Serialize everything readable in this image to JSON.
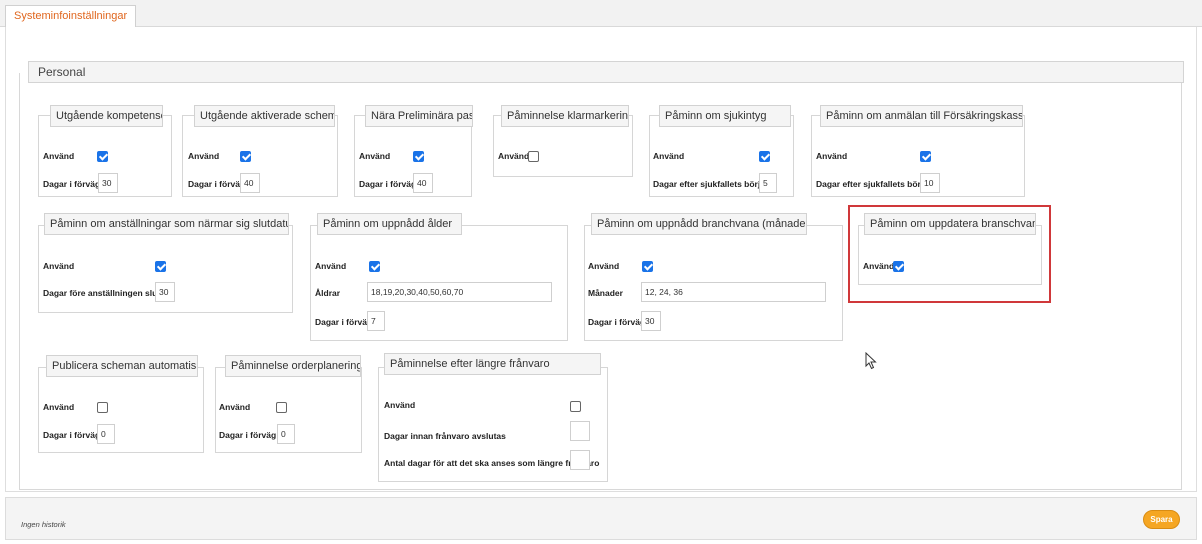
{
  "tab": {
    "label": "Systeminfoinställningar"
  },
  "section": {
    "title": "Personal"
  },
  "groups": [
    {
      "title": "Utgående kompetenser",
      "use_label": "Använd",
      "use_checked": true,
      "field_label": "Dagar i förväg",
      "field_value": "30"
    },
    {
      "title": "Utgående aktiverade scheman",
      "use_label": "Använd",
      "use_checked": true,
      "field_label": "Dagar i förväg",
      "field_value": "40"
    },
    {
      "title": "Nära Preliminära pass",
      "use_label": "Använd",
      "use_checked": true,
      "field_label": "Dagar i förväg",
      "field_value": "40"
    },
    {
      "title": "Påminnelse klarmarkering",
      "use_label": "Använd",
      "use_checked": false
    },
    {
      "title": "Påminn om sjukintyg",
      "use_label": "Använd",
      "use_checked": true,
      "field_label": "Dagar efter sjukfallets början",
      "field_value": "5"
    },
    {
      "title": "Påminn om anmälan till Försäkringskassan",
      "use_label": "Använd",
      "use_checked": true,
      "field_label": "Dagar efter sjukfallets början",
      "field_value": "10"
    },
    {
      "title": "Påminn om anställningar som närmar sig slutdatum",
      "use_label": "Använd",
      "use_checked": true,
      "field_label": "Dagar före anställningen slutar",
      "field_value": "30"
    },
    {
      "title": "Påminn om uppnådd ålder",
      "use_label": "Använd",
      "use_checked": true,
      "field_label": "Åldrar",
      "field_value": "18,19,20,30,40,50,60,70",
      "field2_label": "Dagar i förväg",
      "field2_value": "7"
    },
    {
      "title": "Påminn om uppnådd branchvana (månader)",
      "use_label": "Använd",
      "use_checked": true,
      "field_label": "Månader",
      "field_value": "12, 24, 36",
      "field2_label": "Dagar i förväg",
      "field2_value": "30"
    },
    {
      "title": "Påminn om uppdatera branschvana",
      "use_label": "Använd",
      "use_checked": true
    },
    {
      "title": "Publicera scheman automatiskt",
      "use_label": "Använd",
      "use_checked": false,
      "field_label": "Dagar i förväg",
      "field_value": "0"
    },
    {
      "title": "Påminnelse orderplanering",
      "use_label": "Använd",
      "use_checked": false,
      "field_label": "Dagar i förväg",
      "field_value": "0"
    },
    {
      "title": "Påminnelse efter längre frånvaro",
      "use_label": "Använd",
      "use_checked": false,
      "field_label": "Dagar innan frånvaro avslutas",
      "field_value": "",
      "field2_label": "Antal dagar för att det ska anses som längre frånvaro",
      "field2_value": ""
    }
  ],
  "footer": {
    "history": "Ingen historik",
    "save_label": "Spara"
  },
  "colors": {
    "accent": "#e0661e",
    "checkbox": "#1a73e8",
    "save": "#f5a623",
    "highlight": "#d0383a"
  },
  "icons": {
    "cursor": "mouse-pointer-icon",
    "check": "checkmark-icon"
  }
}
